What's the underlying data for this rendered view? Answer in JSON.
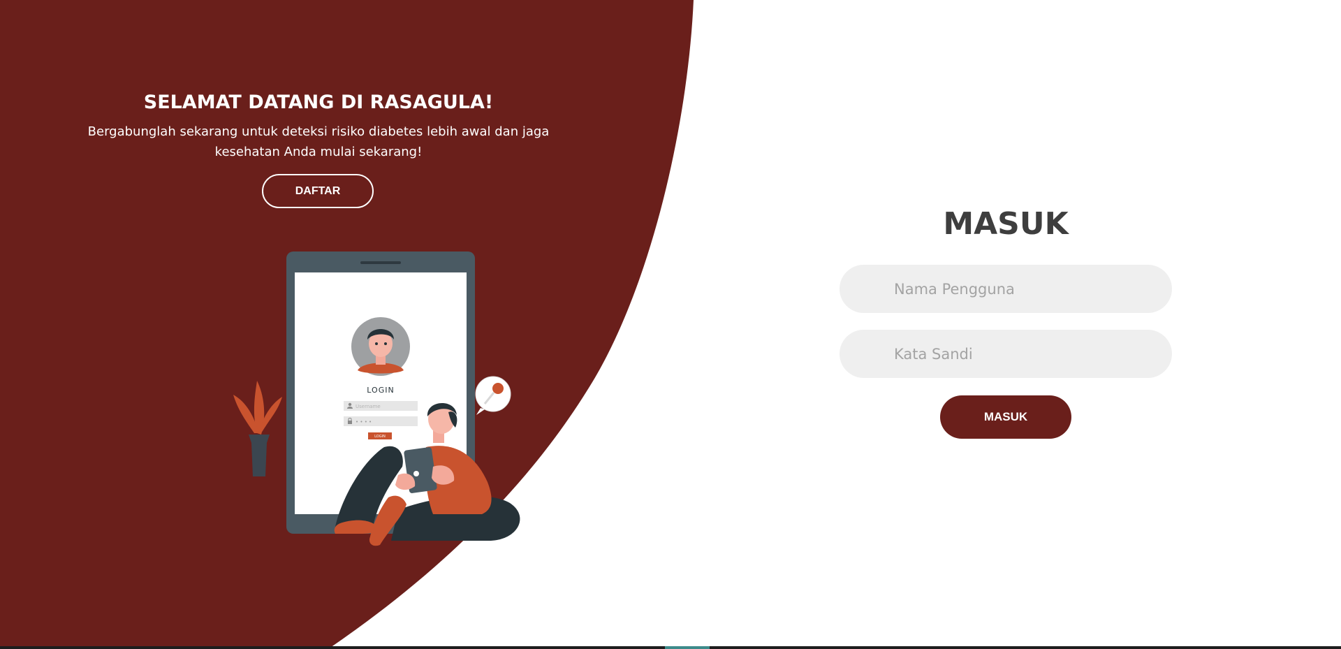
{
  "colors": {
    "brand_maroon": "#6a1f1b",
    "panel_bg": "#ffffff",
    "input_bg": "#efefef",
    "title_gray": "#3e3e3e",
    "accent_orange": "#c9532e",
    "slate": "#4a5a63"
  },
  "welcome": {
    "title": "SELAMAT DATANG DI RASAGULA!",
    "subtitle": "Bergabunglah sekarang untuk deteksi risiko diabetes lebih awal dan jaga kesehatan Anda mulai sekarang!",
    "register_button": "DAFTAR"
  },
  "illustration": {
    "screen_title": "LOGIN",
    "username_placeholder": "Username",
    "password_mask": "• • • •",
    "screen_button": "LOGIN",
    "icons": [
      "user-icon",
      "lock-icon",
      "key-icon"
    ]
  },
  "login": {
    "title": "MASUK",
    "username_placeholder": "Nama Pengguna",
    "password_placeholder": "Kata Sandi",
    "submit_button": "MASUK"
  }
}
